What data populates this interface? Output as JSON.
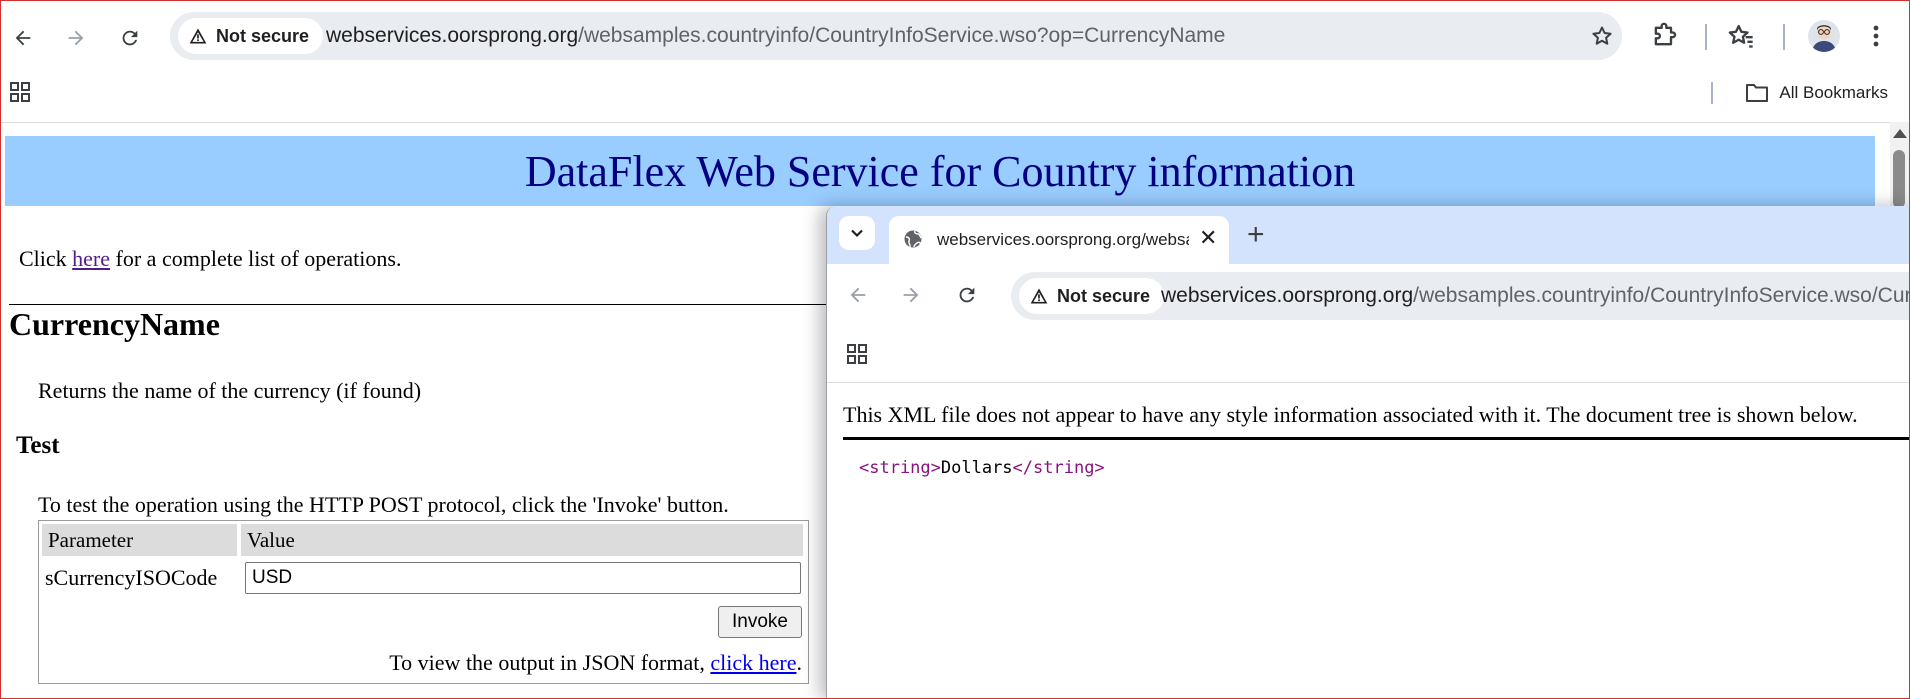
{
  "browser": {
    "security_label": "Not secure",
    "url_host": "webservices.oorsprong.org",
    "url_path": "/websamples.countryinfo/CountryInfoService.wso?op=CurrencyName",
    "bookmarks_label": "All Bookmarks"
  },
  "page": {
    "header_title": "DataFlex Web Service for Country information",
    "intro_prefix": "Click ",
    "intro_link": "here",
    "intro_suffix": " for a complete list of operations.",
    "operation_name": "CurrencyName",
    "operation_description": "Returns the name of the currency (if found)",
    "test_heading": "Test",
    "test_description": "To test the operation using the HTTP POST protocol, click the 'Invoke' button.",
    "table": {
      "col_parameter": "Parameter",
      "col_value": "Value",
      "param_name": "sCurrencyISOCode",
      "param_value": "USD"
    },
    "invoke_label": "Invoke",
    "json_prefix": "To view the output in JSON format, ",
    "json_link": "click here",
    "json_suffix": "."
  },
  "popup": {
    "tab_title": "webservices.oorsprong.org/websamples.countryinfo/CountryInfoService.wso/CurrencyName",
    "security_label": "Not secure",
    "url_host": "webservices.oorsprong.org",
    "url_path": "/websamples.countryinfo/CountryInfoService.wso/CurrencyName",
    "xml_notice": "This XML file does not appear to have any style information associated with it. The document tree is shown below.",
    "xml_open_tag": "<string>",
    "xml_value": "Dollars",
    "xml_close_tag": "</string>"
  }
}
